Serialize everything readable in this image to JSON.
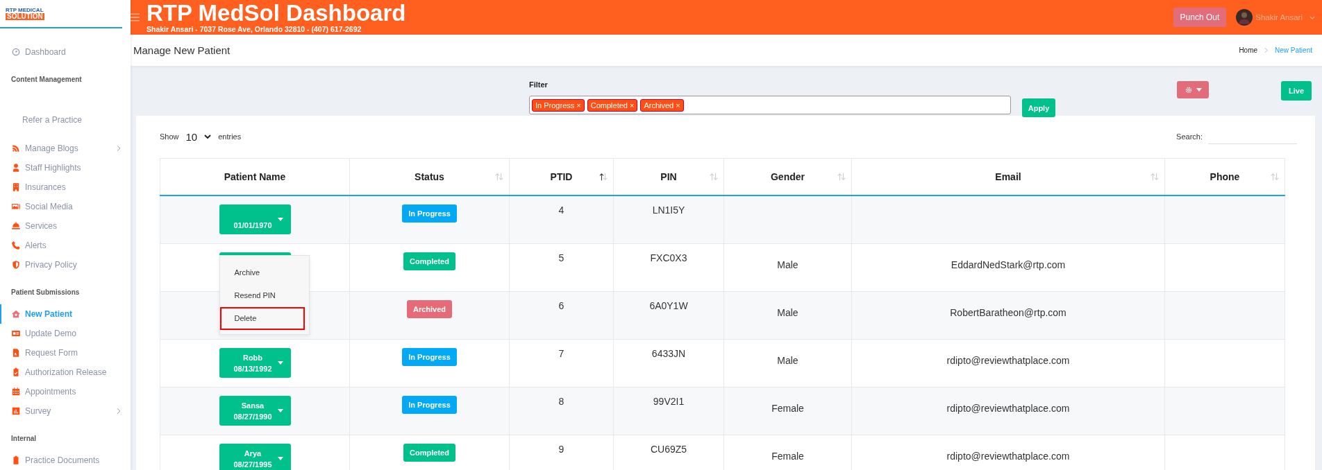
{
  "logo": {
    "line_1": "RTP MEDICAL",
    "line_2": "SOLUTION"
  },
  "header": {
    "title": "RTP MedSol Dashboard",
    "subtitle": "Shakir Ansari - 7037 Rose Ave, Orlando 32810 - (407) 617-2692",
    "punch_button": "Punch Out",
    "user": "Shakir Ansari"
  },
  "sidebar": {
    "sections": [
      {
        "items": [
          {
            "label": "Dashboard",
            "selected": false,
            "expandable": false
          }
        ]
      },
      {
        "title": "Content Management",
        "items": [
          {
            "label": "Refer a Practice",
            "selected": false,
            "expandable": false
          },
          {
            "label": "Manage Blogs",
            "selected": false,
            "expandable": true
          },
          {
            "label": "Staff Highlights",
            "selected": false,
            "expandable": false
          },
          {
            "label": "Insurances",
            "selected": false,
            "expandable": false
          },
          {
            "label": "Social Media",
            "selected": false,
            "expandable": false
          },
          {
            "label": "Services",
            "selected": false,
            "expandable": false
          },
          {
            "label": "Alerts",
            "selected": false,
            "expandable": false
          },
          {
            "label": "Privacy Policy",
            "selected": false,
            "expandable": false
          }
        ]
      },
      {
        "title": "Patient Submissions",
        "items": [
          {
            "label": "New Patient",
            "selected": true,
            "expandable": false
          },
          {
            "label": "Update Demo",
            "selected": false,
            "expandable": false
          },
          {
            "label": "Request Form",
            "selected": false,
            "expandable": false
          },
          {
            "label": "Authorization Release",
            "selected": false,
            "expandable": false
          },
          {
            "label": "Appointments",
            "selected": false,
            "expandable": false
          },
          {
            "label": "Survey",
            "selected": false,
            "expandable": true
          }
        ]
      },
      {
        "title": "Internal",
        "items": [
          {
            "label": "Practice Documents",
            "selected": false,
            "expandable": false
          }
        ]
      }
    ]
  },
  "page_title": "Manage New Patient",
  "breadcrumbs": [
    {
      "label": "Home",
      "selected": false
    },
    {
      "label": "New Patient",
      "selected": true
    }
  ],
  "filter": {
    "label": "Filter",
    "tags": [
      "In Progress ×",
      "Completed ×",
      "Archived ×"
    ],
    "apply_button": "Apply",
    "live_button": "Live"
  },
  "entries": {
    "show_label": "Show",
    "value": "10",
    "suffix": "entries",
    "search_label": "Search:"
  },
  "table": {
    "columns": [
      {
        "label": "Patient Name",
        "sortable": false
      },
      {
        "label": "Status",
        "sortable": true,
        "sorted_ascending": false
      },
      {
        "label": "PTID",
        "sortable": true,
        "sorted_ascending": true
      },
      {
        "label": "PIN",
        "sortable": true,
        "sorted_ascending": false
      },
      {
        "label": "Gender",
        "sortable": true,
        "sorted_ascending": false
      },
      {
        "label": "Email",
        "sortable": true,
        "sorted_ascending": false
      },
      {
        "label": "Phone",
        "sortable": true,
        "sorted_ascending": false
      }
    ],
    "rows": [
      {
        "patient": {
          "dob": "01/01/1970"
        },
        "status": {
          "label": "In Progress",
          "kind": "in_progress"
        },
        "ptid": "4",
        "pin": "LN1I5Y"
      },
      {
        "patient": {
          "menu": [
            {
              "label": "Archive",
              "outlined": false
            },
            {
              "label": "Resend PIN",
              "outlined": false
            },
            {
              "label": "Delete",
              "outlined": true
            }
          ]
        },
        "status": {
          "label": "Completed",
          "kind": "completed"
        },
        "ptid": "5",
        "pin": "FXC0X3",
        "gender": "Male",
        "email": "EddardNedStark@rtp.com"
      },
      {
        "status": {
          "label": "Archived",
          "kind": "archived"
        },
        "ptid": "6",
        "pin": "6A0Y1W",
        "gender": "Male",
        "email": "RobertBaratheon@rtp.com"
      },
      {
        "patient": {
          "name": "Robb",
          "dob": "08/13/1992"
        },
        "status": {
          "label": "In Progress",
          "kind": "in_progress"
        },
        "ptid": "7",
        "pin": "6433JN",
        "gender": "Male",
        "email": "rdipto@reviewthatplace.com"
      },
      {
        "patient": {
          "name": "Sansa",
          "dob": "08/27/1990"
        },
        "status": {
          "label": "In Progress",
          "kind": "in_progress"
        },
        "ptid": "8",
        "pin": "99V2I1",
        "gender": "Female",
        "email": "rdipto@reviewthatplace.com"
      },
      {
        "patient": {
          "name": "Arya",
          "dob": "08/27/1995"
        },
        "status": {
          "label": "Completed",
          "kind": "completed"
        },
        "ptid": "9",
        "pin": "CU69Z5",
        "gender": "Female",
        "email": "rdipto@reviewthatplace.com"
      }
    ]
  }
}
